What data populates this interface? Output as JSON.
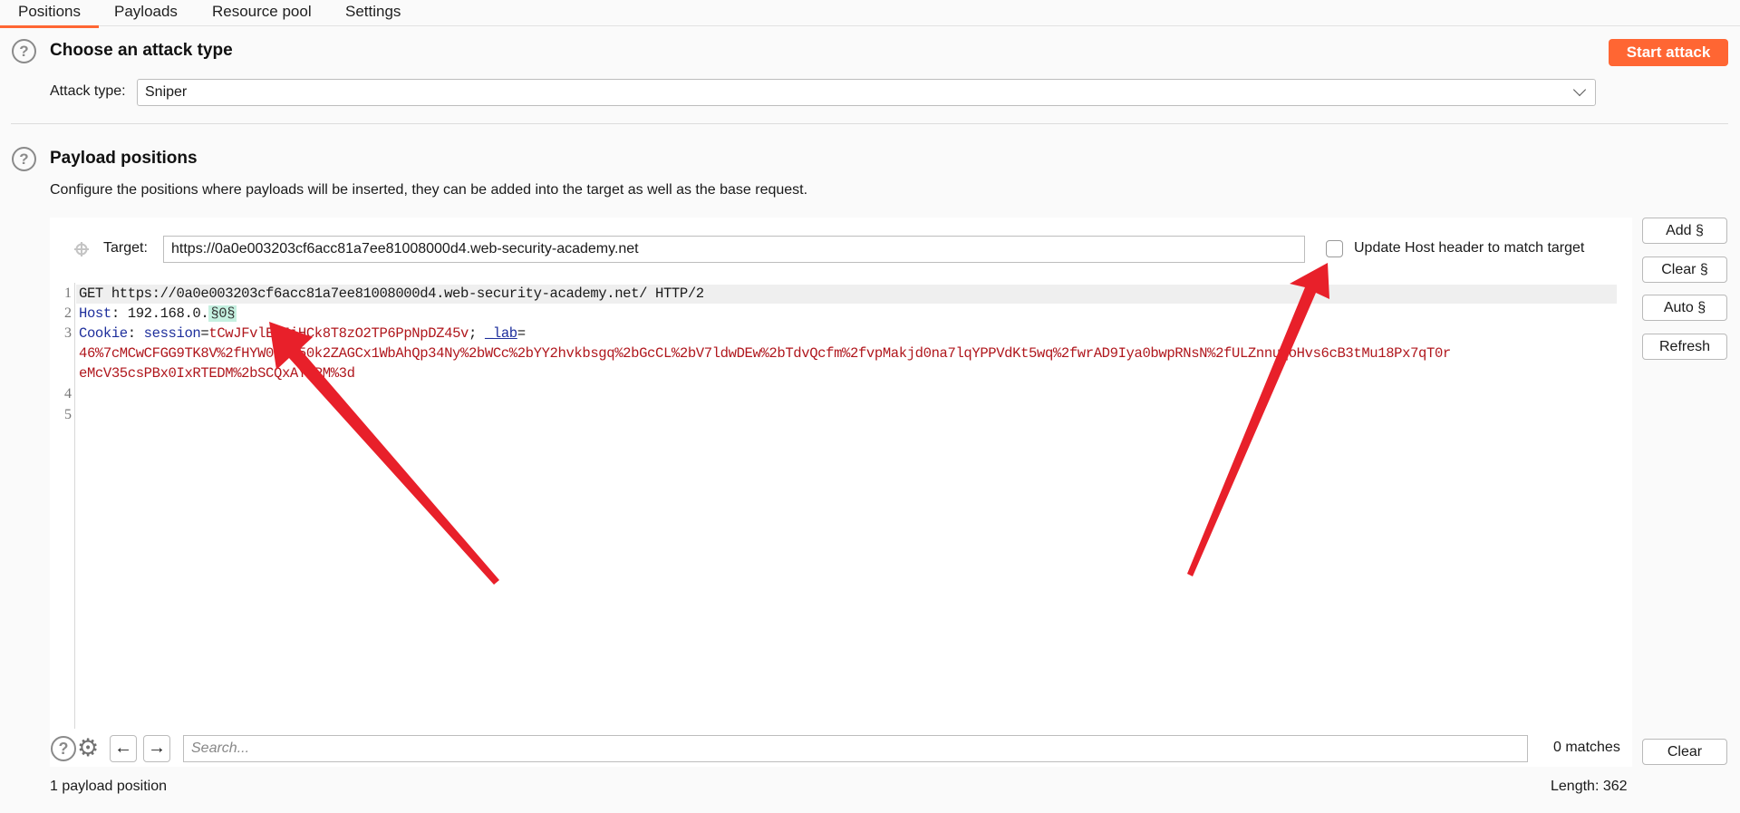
{
  "tabs": [
    {
      "label": "Positions",
      "active": true
    },
    {
      "label": "Payloads",
      "active": false
    },
    {
      "label": "Resource pool",
      "active": false
    },
    {
      "label": "Settings",
      "active": false
    }
  ],
  "attack_section": {
    "title": "Choose an attack type",
    "start_button": "Start attack",
    "attack_type_label": "Attack type:",
    "attack_type_value": "Sniper"
  },
  "positions_section": {
    "title": "Payload positions",
    "description": "Configure the positions where payloads will be inserted, they can be added into the target as well as the base request.",
    "target_label": "Target:",
    "target_value": "https://0a0e003203cf6acc81a7ee81008000d4.web-security-academy.net",
    "update_host_label": "Update Host header to match target",
    "update_host_checked": false,
    "side_buttons": [
      "Add §",
      "Clear §",
      "Auto §",
      "Refresh"
    ]
  },
  "editor": {
    "line_numbers": [
      "1",
      "2",
      "3",
      "4",
      "5"
    ],
    "line1": "GET https://0a0e003203cf6acc81a7ee81008000d4.web-security-academy.net/ HTTP/2",
    "line2": {
      "name": "Host",
      "value": "192.168.0.",
      "marker": "§0§"
    },
    "line3": {
      "name": "Cookie",
      "cookie1_name": "session",
      "cookie1_value": "tCwJFvlEoJiHCk8T8zO2TP6PpNpDZ45v",
      "cookie2_name": "_lab",
      "cookie2_value_a": "46%7cMCwCFGG9TK8V%2fHYW0xUf50k2ZAGCx1WbAhQp34Ny%2bWCc%2bYY2hvkbsgq%2bGcCL%2bV7ldwDEw%2bTdvQcfm%2fvpMakjd0na7lqYPPVdKt5wq%2fwrAD9Iya0bwpRNsN%2fULZnnuqoHvs6cB3tMu18Px7qT0r",
      "cookie2_value_b": "eMcV35csPBx0IxRTEDM%2bSCQxAYxPM%3d"
    }
  },
  "search": {
    "placeholder": "Search...",
    "matches": "0 matches",
    "clear_label": "Clear"
  },
  "footer": {
    "payload_count": "1 payload position",
    "length": "Length: 362"
  },
  "annotation_color": "#e8202a"
}
